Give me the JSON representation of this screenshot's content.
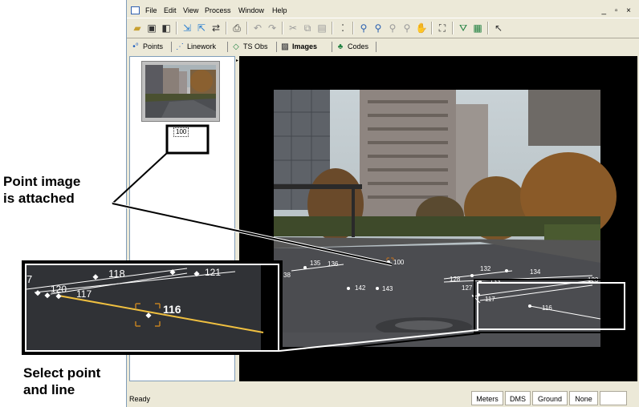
{
  "window": {
    "menu": [
      "File",
      "Edit",
      "View",
      "Process",
      "Window",
      "Help"
    ],
    "controls": "_ ▫ ×"
  },
  "tabs": [
    {
      "label": "Points",
      "icon": "points-icon",
      "glyph": "•°"
    },
    {
      "label": "Linework",
      "icon": "linework-icon",
      "glyph": "⋰"
    },
    {
      "label": "TS Obs",
      "icon": "ts-obs-icon",
      "glyph": "◇"
    },
    {
      "label": "Images",
      "icon": "images-icon",
      "glyph": "▨"
    },
    {
      "label": "Codes",
      "icon": "codes-icon",
      "glyph": "♣"
    }
  ],
  "thumbnail": {
    "label": "100"
  },
  "status": {
    "text": "Ready",
    "panels": [
      "Meters",
      "DMS",
      "Ground",
      "None",
      ""
    ]
  },
  "callouts": {
    "point_image": [
      "Point image",
      "is attached"
    ],
    "select_point": [
      "Select point",
      "and line"
    ]
  },
  "photo_points": [
    {
      "label": "100"
    },
    {
      "label": "135"
    },
    {
      "label": "136"
    },
    {
      "label": "38"
    },
    {
      "label": "142"
    },
    {
      "label": "143"
    },
    {
      "label": "132"
    },
    {
      "label": "134"
    },
    {
      "label": "133"
    },
    {
      "label": "123"
    },
    {
      "label": "127"
    },
    {
      "label": "117"
    },
    {
      "label": "116"
    },
    {
      "label": "128"
    }
  ],
  "inset_points": [
    {
      "label": "118"
    },
    {
      "label": "7"
    },
    {
      "label": "120"
    },
    {
      "label": "117"
    },
    {
      "label": "116"
    },
    {
      "label": "121"
    }
  ],
  "colors": {
    "chrome": "#ece9d8",
    "selection_line": "#f0c040",
    "callout_box": "#000000"
  }
}
